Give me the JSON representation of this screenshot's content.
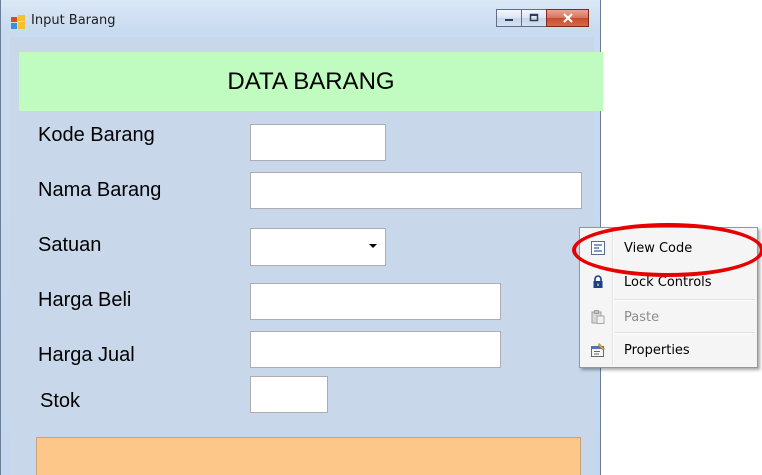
{
  "window": {
    "title": "Input Barang",
    "icon": "windows-form-icon",
    "caption_buttons": [
      "minimize",
      "maximize",
      "close"
    ]
  },
  "form": {
    "header": "DATA BARANG",
    "fields": [
      {
        "label": "Kode Barang",
        "value": ""
      },
      {
        "label": "Nama Barang",
        "value": ""
      },
      {
        "label": "Satuan",
        "value": "",
        "type": "dropdown"
      },
      {
        "label": "Harga Beli",
        "value": ""
      },
      {
        "label": "Harga Jual",
        "value": ""
      },
      {
        "label": "Stok",
        "value": ""
      }
    ]
  },
  "context_menu": {
    "items": [
      {
        "label": "View Code",
        "icon": "view-code-icon",
        "enabled": true
      },
      {
        "label": "Lock Controls",
        "icon": "lock-icon",
        "enabled": true
      },
      {
        "label": "Paste",
        "icon": "paste-icon",
        "enabled": false
      },
      {
        "label": "Properties",
        "icon": "properties-icon",
        "enabled": true
      }
    ]
  },
  "colors": {
    "header_panel": "#c0fcc0",
    "form_background": "#c8d8ea",
    "bottom_panel": "#fec78a",
    "highlight": "#e60000"
  }
}
